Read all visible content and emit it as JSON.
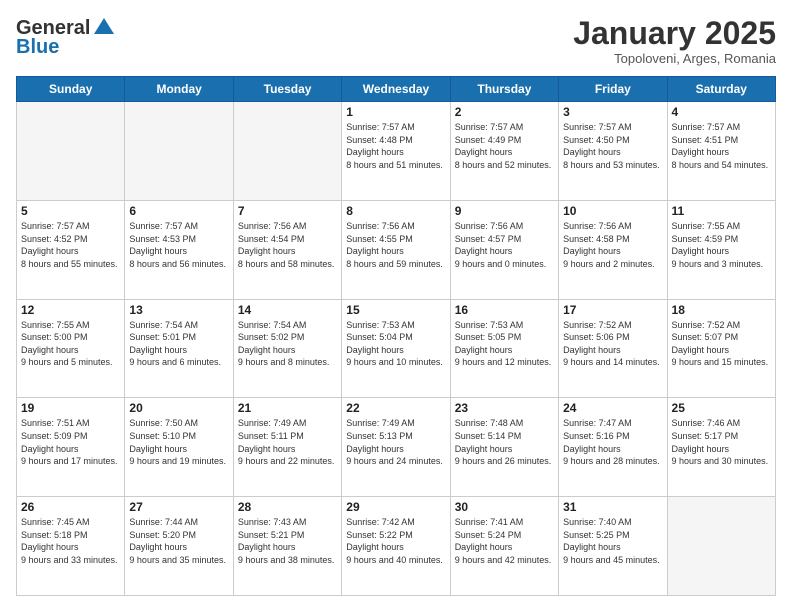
{
  "header": {
    "logo_general": "General",
    "logo_blue": "Blue",
    "month_title": "January 2025",
    "location": "Topoloveni, Arges, Romania"
  },
  "days_of_week": [
    "Sunday",
    "Monday",
    "Tuesday",
    "Wednesday",
    "Thursday",
    "Friday",
    "Saturday"
  ],
  "weeks": [
    [
      {
        "day": "",
        "empty": true
      },
      {
        "day": "",
        "empty": true
      },
      {
        "day": "",
        "empty": true
      },
      {
        "day": "1",
        "sunrise": "7:57 AM",
        "sunset": "4:48 PM",
        "daylight": "8 hours and 51 minutes."
      },
      {
        "day": "2",
        "sunrise": "7:57 AM",
        "sunset": "4:49 PM",
        "daylight": "8 hours and 52 minutes."
      },
      {
        "day": "3",
        "sunrise": "7:57 AM",
        "sunset": "4:50 PM",
        "daylight": "8 hours and 53 minutes."
      },
      {
        "day": "4",
        "sunrise": "7:57 AM",
        "sunset": "4:51 PM",
        "daylight": "8 hours and 54 minutes."
      }
    ],
    [
      {
        "day": "5",
        "sunrise": "7:57 AM",
        "sunset": "4:52 PM",
        "daylight": "8 hours and 55 minutes."
      },
      {
        "day": "6",
        "sunrise": "7:57 AM",
        "sunset": "4:53 PM",
        "daylight": "8 hours and 56 minutes."
      },
      {
        "day": "7",
        "sunrise": "7:56 AM",
        "sunset": "4:54 PM",
        "daylight": "8 hours and 58 minutes."
      },
      {
        "day": "8",
        "sunrise": "7:56 AM",
        "sunset": "4:55 PM",
        "daylight": "8 hours and 59 minutes."
      },
      {
        "day": "9",
        "sunrise": "7:56 AM",
        "sunset": "4:57 PM",
        "daylight": "9 hours and 0 minutes."
      },
      {
        "day": "10",
        "sunrise": "7:56 AM",
        "sunset": "4:58 PM",
        "daylight": "9 hours and 2 minutes."
      },
      {
        "day": "11",
        "sunrise": "7:55 AM",
        "sunset": "4:59 PM",
        "daylight": "9 hours and 3 minutes."
      }
    ],
    [
      {
        "day": "12",
        "sunrise": "7:55 AM",
        "sunset": "5:00 PM",
        "daylight": "9 hours and 5 minutes."
      },
      {
        "day": "13",
        "sunrise": "7:54 AM",
        "sunset": "5:01 PM",
        "daylight": "9 hours and 6 minutes."
      },
      {
        "day": "14",
        "sunrise": "7:54 AM",
        "sunset": "5:02 PM",
        "daylight": "9 hours and 8 minutes."
      },
      {
        "day": "15",
        "sunrise": "7:53 AM",
        "sunset": "5:04 PM",
        "daylight": "9 hours and 10 minutes."
      },
      {
        "day": "16",
        "sunrise": "7:53 AM",
        "sunset": "5:05 PM",
        "daylight": "9 hours and 12 minutes."
      },
      {
        "day": "17",
        "sunrise": "7:52 AM",
        "sunset": "5:06 PM",
        "daylight": "9 hours and 14 minutes."
      },
      {
        "day": "18",
        "sunrise": "7:52 AM",
        "sunset": "5:07 PM",
        "daylight": "9 hours and 15 minutes."
      }
    ],
    [
      {
        "day": "19",
        "sunrise": "7:51 AM",
        "sunset": "5:09 PM",
        "daylight": "9 hours and 17 minutes."
      },
      {
        "day": "20",
        "sunrise": "7:50 AM",
        "sunset": "5:10 PM",
        "daylight": "9 hours and 19 minutes."
      },
      {
        "day": "21",
        "sunrise": "7:49 AM",
        "sunset": "5:11 PM",
        "daylight": "9 hours and 22 minutes."
      },
      {
        "day": "22",
        "sunrise": "7:49 AM",
        "sunset": "5:13 PM",
        "daylight": "9 hours and 24 minutes."
      },
      {
        "day": "23",
        "sunrise": "7:48 AM",
        "sunset": "5:14 PM",
        "daylight": "9 hours and 26 minutes."
      },
      {
        "day": "24",
        "sunrise": "7:47 AM",
        "sunset": "5:16 PM",
        "daylight": "9 hours and 28 minutes."
      },
      {
        "day": "25",
        "sunrise": "7:46 AM",
        "sunset": "5:17 PM",
        "daylight": "9 hours and 30 minutes."
      }
    ],
    [
      {
        "day": "26",
        "sunrise": "7:45 AM",
        "sunset": "5:18 PM",
        "daylight": "9 hours and 33 minutes."
      },
      {
        "day": "27",
        "sunrise": "7:44 AM",
        "sunset": "5:20 PM",
        "daylight": "9 hours and 35 minutes."
      },
      {
        "day": "28",
        "sunrise": "7:43 AM",
        "sunset": "5:21 PM",
        "daylight": "9 hours and 38 minutes."
      },
      {
        "day": "29",
        "sunrise": "7:42 AM",
        "sunset": "5:22 PM",
        "daylight": "9 hours and 40 minutes."
      },
      {
        "day": "30",
        "sunrise": "7:41 AM",
        "sunset": "5:24 PM",
        "daylight": "9 hours and 42 minutes."
      },
      {
        "day": "31",
        "sunrise": "7:40 AM",
        "sunset": "5:25 PM",
        "daylight": "9 hours and 45 minutes."
      },
      {
        "day": "",
        "empty": true
      }
    ]
  ],
  "labels": {
    "sunrise": "Sunrise:",
    "sunset": "Sunset:",
    "daylight": "Daylight hours"
  }
}
